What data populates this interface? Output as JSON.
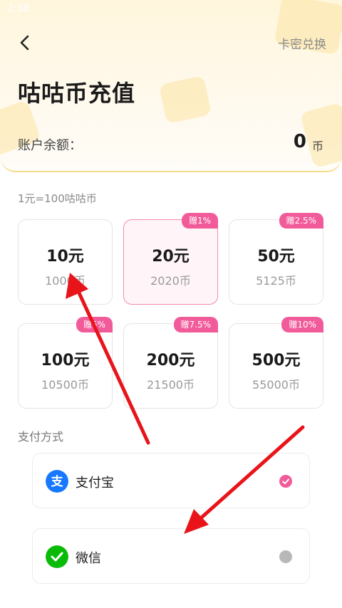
{
  "status_bar": {
    "time": "2:38"
  },
  "header": {
    "card_redeem_label": "卡密兑换",
    "title": "咕咕币充值",
    "balance_label": "账户余额：",
    "balance_value": "0",
    "balance_unit": "币"
  },
  "rate_note": "1元=100咕咕币",
  "options": [
    {
      "price": "10元",
      "coins": "1000币",
      "bonus": "",
      "selected": false
    },
    {
      "price": "20元",
      "coins": "2020币",
      "bonus": "赠1%",
      "selected": true
    },
    {
      "price": "50元",
      "coins": "5125币",
      "bonus": "赠2.5%",
      "selected": false
    },
    {
      "price": "100元",
      "coins": "10500币",
      "bonus": "赠5%",
      "selected": false
    },
    {
      "price": "200元",
      "coins": "21500币",
      "bonus": "赠7.5%",
      "selected": false
    },
    {
      "price": "500元",
      "coins": "55000币",
      "bonus": "赠10%",
      "selected": false
    }
  ],
  "payment": {
    "heading": "支付方式",
    "methods": [
      {
        "name": "支付宝",
        "icon": "alipay-icon",
        "selected": true
      },
      {
        "name": "微信",
        "icon": "wechat-icon",
        "selected": false
      }
    ]
  },
  "colors": {
    "accent": "#f25b9a",
    "alipay": "#1677ff",
    "wechat": "#09bb07",
    "annotation": "#e8141a"
  }
}
